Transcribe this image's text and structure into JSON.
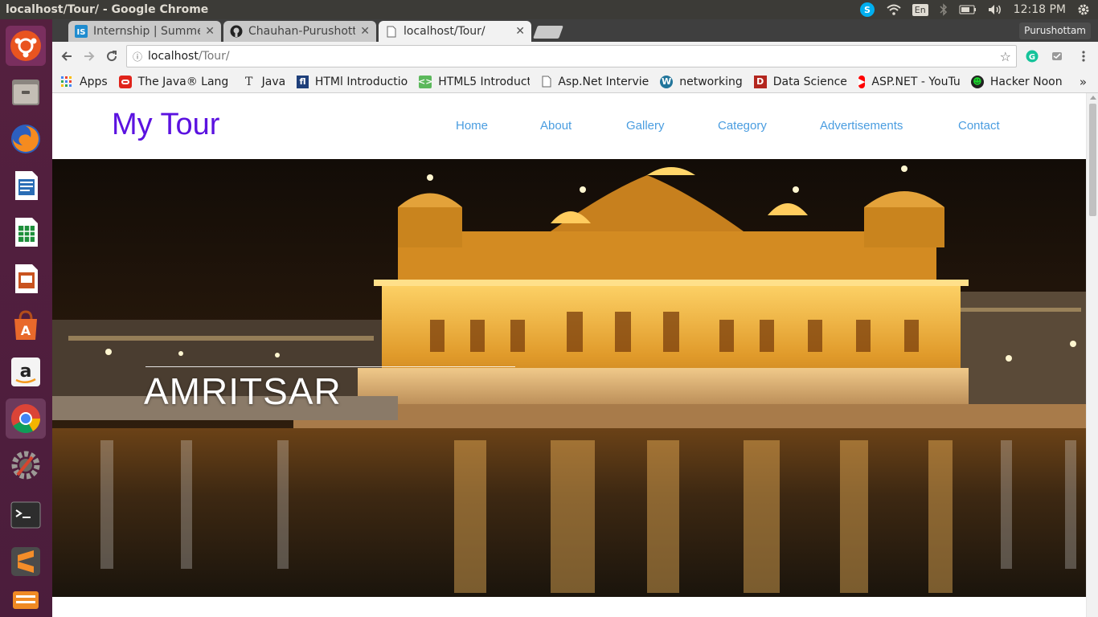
{
  "window_title": "localhost/Tour/ - Google Chrome",
  "system": {
    "keyboard_layout": "En",
    "clock": "12:18 PM"
  },
  "browser": {
    "tabs": [
      {
        "label": "Internship | Summe",
        "favicon": "internshala-icon",
        "active": false
      },
      {
        "label": "Chauhan-Purushott",
        "favicon": "github-icon",
        "active": false
      },
      {
        "label": "localhost/Tour/",
        "favicon": "page-icon",
        "active": true
      }
    ],
    "profile_name": "Purushottam",
    "address": {
      "host": "localhost",
      "path": "/Tour/"
    },
    "bookmarks": [
      {
        "label": "Apps",
        "icon": "apps-grid-icon"
      },
      {
        "label": "The Java® Lang",
        "icon": "oracle-icon"
      },
      {
        "label": "Java",
        "icon": "text-t-icon"
      },
      {
        "label": "HTMl Introductio",
        "icon": "fl-icon"
      },
      {
        "label": "HTML5 Introduct",
        "icon": "html5-icon"
      },
      {
        "label": "Asp.Net Intervie",
        "icon": "page-icon"
      },
      {
        "label": "networking",
        "icon": "wordpress-icon"
      },
      {
        "label": "Data Science",
        "icon": "ds-icon"
      },
      {
        "label": "ASP.NET - YouTu",
        "icon": "youtube-icon"
      },
      {
        "label": "Hacker Noon",
        "icon": "hackernoon-icon"
      }
    ],
    "bookmarks_overflow": "»"
  },
  "site": {
    "brand": "My Tour",
    "nav": [
      "Home",
      "About",
      "Gallery",
      "Category",
      "Advertisements",
      "Contact"
    ],
    "hero_caption": "AMRITSAR"
  },
  "colors": {
    "brand": "#5b12e0",
    "nav_link": "#4a9de0",
    "launcher_bg": "#4b1d3c",
    "panel_bg": "#3c3b37"
  }
}
